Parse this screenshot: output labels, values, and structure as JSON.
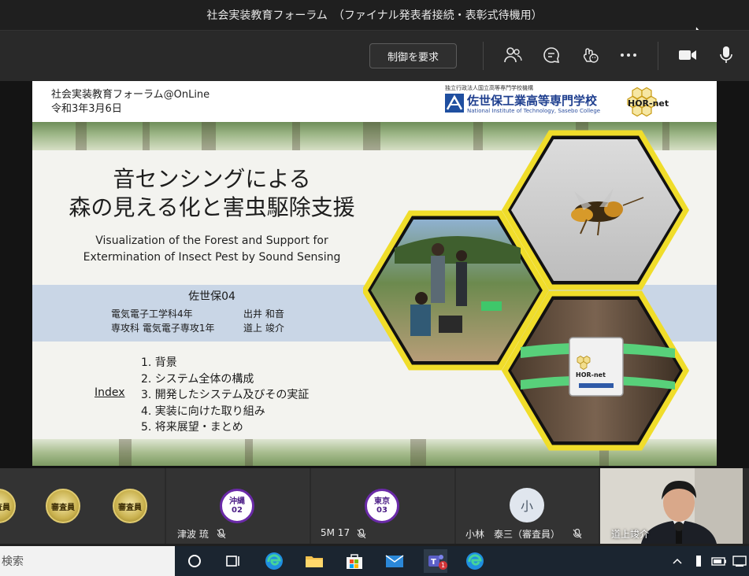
{
  "window": {
    "title": "社会実装教育フォーラム　（ファイナル発表者接続・表彰式待機用）"
  },
  "meeting_toolbar": {
    "request_control_label": "制御を要求",
    "icons": [
      "people-icon",
      "chat-icon",
      "reactions-icon",
      "more-icon",
      "camera-icon",
      "microphone-icon"
    ]
  },
  "slide": {
    "forum_name": "社会実装教育フォーラム@OnLine",
    "date": "令和3年3月6日",
    "school_small": "独立行政法人国立高等専門学校機構",
    "school_name": "佐世保工業高等専門学校",
    "school_english": "National Institute of Technology, Sasebo College",
    "hornet_logo": "HOR-net",
    "title_line1": "音センシングによる",
    "title_line2": "森の見える化と害虫駆除支援",
    "subtitle_line1": "Visualization of the Forest and Support for",
    "subtitle_line2": "Extermination of Insect Pest by Sound Sensing",
    "team": "佐世保04",
    "member1_affiliation": "電気電子工学科4年",
    "member1_name": "出井 和音",
    "member2_affiliation": "専攻科 電気電子専攻1年",
    "member2_name": "道上 竣介",
    "index_label": "Index",
    "index_items": [
      "1. 背景",
      "2. システム全体の構成",
      "3. 開発したシステム及びその実証",
      "4. 実装に向けた取り組み",
      "5. 将来展望・まとめ"
    ],
    "device_logo": "HOR-net"
  },
  "participants": [
    {
      "badge": "審査員"
    },
    {
      "badge": "審査員"
    },
    {
      "badge": "審査員"
    },
    {
      "badge_line1": "沖縄",
      "badge_line2": "02",
      "name": "津波 琉"
    },
    {
      "badge_line1": "東京",
      "badge_line2": "03",
      "name": "5M 17"
    },
    {
      "initial": "小",
      "name": "小林　泰三（審査員）"
    },
    {
      "name": "道上竣介"
    }
  ],
  "taskbar": {
    "search_placeholder": "検索",
    "teams_badge": "1"
  }
}
